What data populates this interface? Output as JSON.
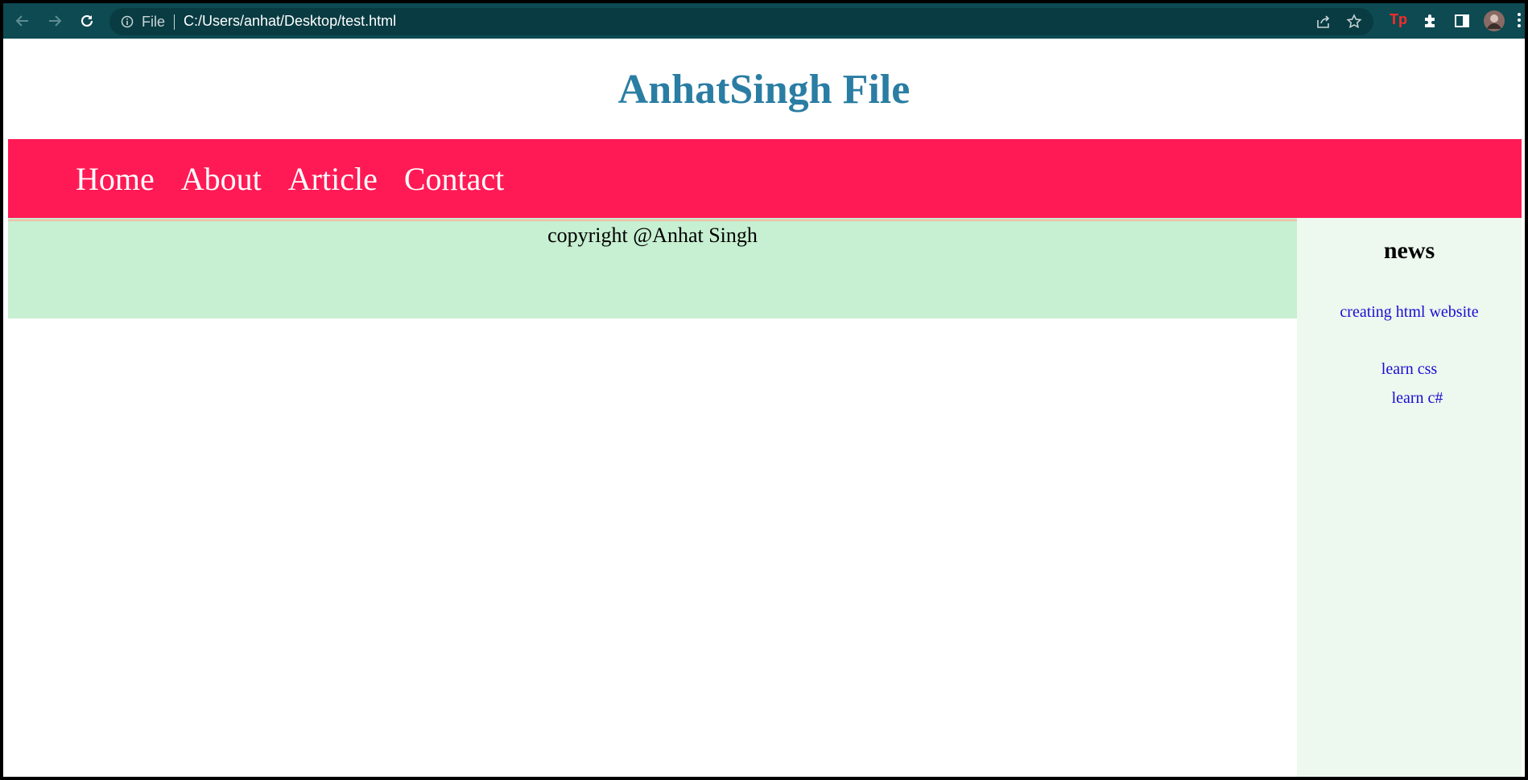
{
  "browser": {
    "file_label": "File",
    "url": "C:/Users/anhat/Desktop/test.html",
    "extension_label": "Tp"
  },
  "page": {
    "title": "AnhatSingh File",
    "nav": [
      "Home",
      "About",
      "Article",
      "Contact"
    ],
    "copyright": "copyright @Anhat Singh",
    "sidebar": {
      "title": "news",
      "links": [
        "creating html website",
        "learn css",
        "learn c#"
      ]
    }
  },
  "colors": {
    "toolbar": "#0d4a52",
    "title": "#2a7da3",
    "navbar": "#ff1a55",
    "footer": "#c7efd1",
    "sidebar": "#edf8ee",
    "link": "#1a0dd4"
  }
}
